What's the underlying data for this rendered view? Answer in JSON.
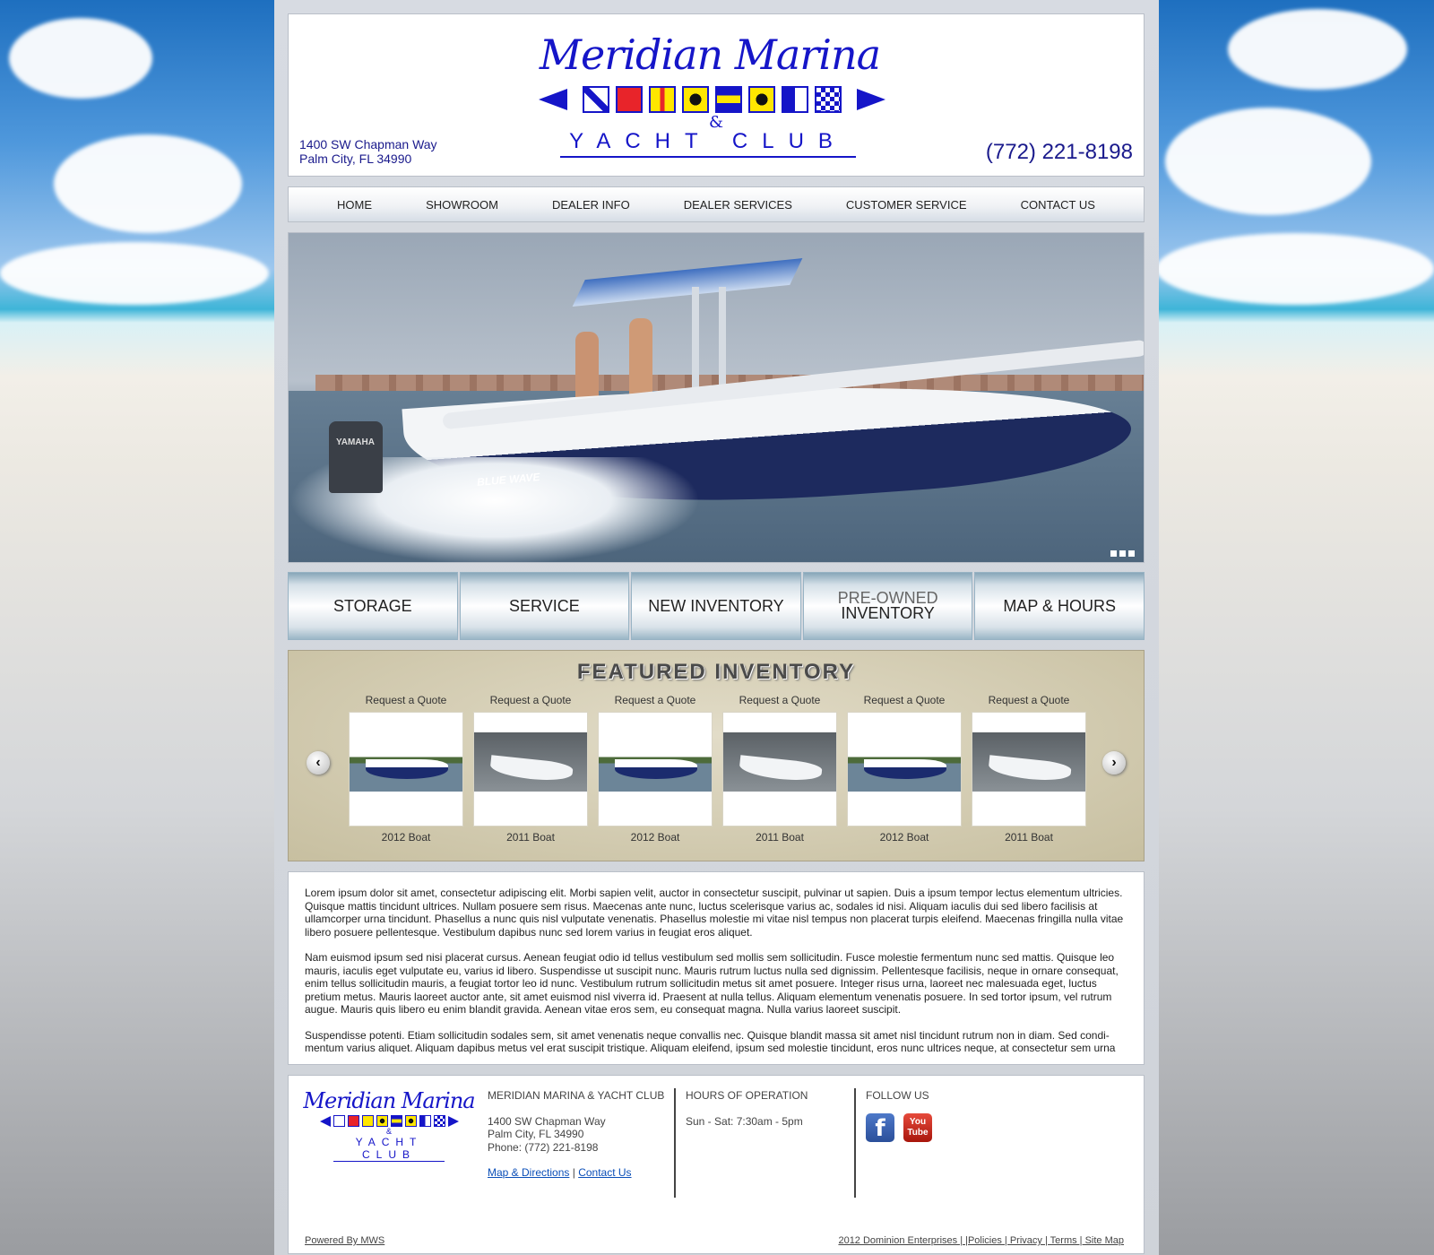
{
  "header": {
    "logo_title": "Meridian Marina",
    "logo_amp": "&",
    "logo_sub": "YACHT CLUB",
    "address_line1": "1400 SW Chapman Way",
    "address_line2": "Palm City, FL 34990",
    "phone": "(772) 221-8198"
  },
  "nav": [
    "HOME",
    "SHOWROOM",
    "DEALER INFO",
    "DEALER SERVICES",
    "CUSTOMER SERVICE",
    "CONTACT US"
  ],
  "hero": {
    "brand_text": "BLUE WAVE",
    "motor_text": "YAMAHA"
  },
  "buttons": {
    "storage": "STORAGE",
    "service": "SERVICE",
    "new_inventory": "NEW INVENTORY",
    "preowned_line1": "PRE-OWNED",
    "preowned_line2": "INVENTORY",
    "map_hours": "MAP & HOURS"
  },
  "featured": {
    "title": "FEATURED INVENTORY",
    "items": [
      {
        "quote": "Request a Quote",
        "label": "2012 Boat"
      },
      {
        "quote": "Request a Quote",
        "label": "2011 Boat"
      },
      {
        "quote": "Request a Quote",
        "label": "2012 Boat"
      },
      {
        "quote": "Request a Quote",
        "label": "2011 Boat"
      },
      {
        "quote": "Request a Quote",
        "label": "2012 Boat"
      },
      {
        "quote": "Request a Quote",
        "label": "2011 Boat"
      }
    ]
  },
  "content": {
    "p1": "Lorem ipsum dolor sit amet, consectetur adipiscing elit. Morbi sapien velit, auctor in consectetur suscipit, pulvinar ut sapien. Duis a ipsum tempor lectus elementum ultricies. Quisque mattis tincidunt ultrices. Nullam posuere sem risus. Maecenas ante nunc, luctus scelerisque varius ac, sodales id nisi. Aliquam iaculis dui sed libero facilisis at ullamcorper urna tincidunt. Phasellus a nunc quis nisl vulputate venenatis. Phasellus molestie mi vitae nisl tempus non placerat turpis eleifend. Maecenas fringilla nulla vitae libero posuere pellentesque. Vestibulum dapibus nunc sed lorem varius in feugiat eros aliquet.",
    "p2": "Nam euismod ipsum sed nisi placerat cursus. Aenean feugiat odio id tellus vestibulum sed mollis sem sollicitudin. Fusce molestie fermentum nunc sed mattis. Quisque leo mauris, iaculis eget vulputate eu, varius id libero. Suspendisse ut suscipit nunc. Mauris rutrum luctus nulla sed dignissim. Pellentesque facilisis, neque in ornare consequat, enim tellus sollicitudin mauris, a feugiat tortor leo id nunc. Vestibulum rutrum sollicitudin metus sit amet posuere. Integer risus urna, laoreet nec malesuada eget, luctus pretium metus. Mauris laoreet auctor ante, sit amet euismod nisl viverra id. Praesent at nulla tellus. Aliquam elementum venenatis posuere. In sed tortor ipsum, vel rutrum augue. Mauris quis libero eu enim blandit gravida. Aenean vitae eros sem, eu consequat magna. Nulla varius laoreet suscipit.",
    "p3": "Suspendisse potenti. Etiam sollicitudin sodales sem, sit amet venenatis neque convallis nec. Quisque blandit massa sit amet nisl tincidunt rutrum non in diam. Sed condi-mentum varius aliquet. Aliquam dapibus metus vel erat suscipit tristique. Aliquam eleifend, ipsum sed molestie tincidunt, eros nunc ultrices neque, at consectetur sem urna"
  },
  "footer": {
    "logo_title": "Meridian Marina",
    "logo_amp": "&",
    "logo_sub": "YACHT CLUB",
    "company": "MERIDIAN MARINA & YACHT CLUB",
    "address_line1": "1400 SW Chapman Way",
    "address_line2": "Palm City, FL 34990",
    "phone": "Phone: (772) 221-8198",
    "link_map": "Map & Directions",
    "link_sep": "|",
    "link_contact": "Contact Us",
    "hours_title": "HOURS OF OPERATION",
    "hours": "Sun - Sat: 7:30am - 5pm",
    "follow_title": "FOLLOW US",
    "facebook_icon": "f",
    "youtube_icon_line1": "You",
    "youtube_icon_line2": "Tube",
    "powered": "Powered By MWS",
    "legal": "2012 Dominion Enterprises | |Policies | Privacy | Terms | Site Map"
  },
  "colors": {
    "brand_blue": "#1515c8",
    "link_blue": "#0b4fb8"
  }
}
